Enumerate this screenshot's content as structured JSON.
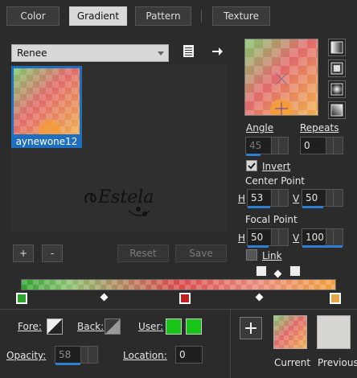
{
  "tabs": [
    {
      "label": "Color"
    },
    {
      "label": "Gradient"
    },
    {
      "label": "Pattern"
    },
    {
      "label": "Texture"
    }
  ],
  "gradient_set": {
    "selected": "Renee"
  },
  "gradient_item": {
    "label": "aynewone12"
  },
  "buttons": {
    "add": "+",
    "remove": "-",
    "reset": "Reset",
    "save": "Save"
  },
  "angle": {
    "label": "Angle",
    "value": "45"
  },
  "repeats": {
    "label": "Repeats",
    "value": "0"
  },
  "invert": {
    "label": "Invert",
    "checked": true
  },
  "center_point": {
    "label": "Center Point",
    "h_label": "H",
    "h_value": "53",
    "v_label": "V",
    "v_value": "50"
  },
  "focal_point": {
    "label": "Focal Point",
    "h_label": "H",
    "h_value": "50",
    "v_label": "V",
    "v_value": "100"
  },
  "link": {
    "label": "Link"
  },
  "fore": {
    "label": "Fore:"
  },
  "back": {
    "label": "Back:"
  },
  "user": {
    "label": "User:"
  },
  "opacity": {
    "label": "Opacity:",
    "value": "58"
  },
  "location": {
    "label": "Location:",
    "value": "0"
  },
  "current": {
    "label": "Current"
  },
  "previous": {
    "label": "Previous"
  },
  "colors": {
    "accent": "#2f7fd0",
    "user1": "#19c419",
    "user2": "#19c419",
    "stop_green": "#2da52d",
    "stop_red": "#c42020",
    "stop_orange": "#e8a74a",
    "previous_swatch": "#d8d6d2"
  },
  "icons": {
    "list": "list-icon",
    "arrow": "arrow-right-icon",
    "linear": "linear-gradient-icon",
    "rectangular": "rectangular-gradient-icon",
    "sunburst": "sunburst-gradient-icon",
    "radial": "radial-gradient-icon"
  }
}
